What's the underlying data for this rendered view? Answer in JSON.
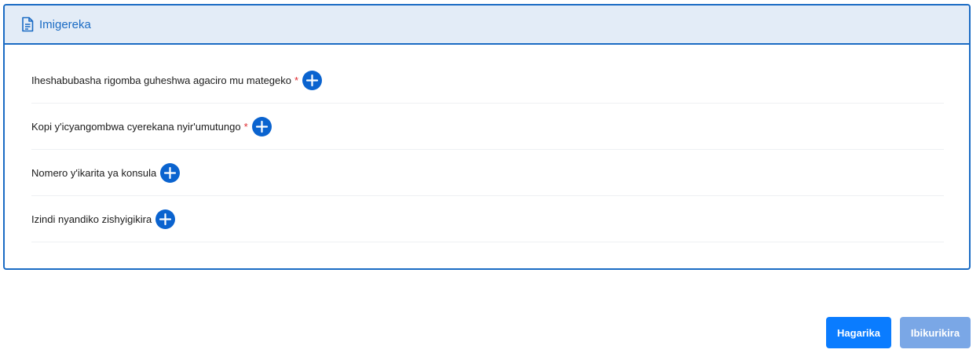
{
  "panel": {
    "title": "Imigereka",
    "icon": "document-icon",
    "accent_color": "#1a6bc4",
    "header_bg": "#e3ecf7"
  },
  "attachments": [
    {
      "label": "Iheshabubasha rigomba guheshwa agaciro mu mategeko",
      "required": "*",
      "action_icon": "plus-circle-icon"
    },
    {
      "label": "Kopi y'icyangombwa cyerekana nyir'umutungo",
      "required": "*",
      "action_icon": "plus-circle-icon"
    },
    {
      "label": "Nomero y'ikarita ya konsula",
      "required": "",
      "action_icon": "plus-circle-icon"
    },
    {
      "label": "Izindi nyandiko zishyigikira",
      "required": "",
      "action_icon": "plus-circle-icon"
    }
  ],
  "footer": {
    "cancel_label": "Hagarika",
    "submit_label": "Ibikurikira",
    "cancel_color": "#0a7cff",
    "submit_color": "#7aa7e6"
  }
}
